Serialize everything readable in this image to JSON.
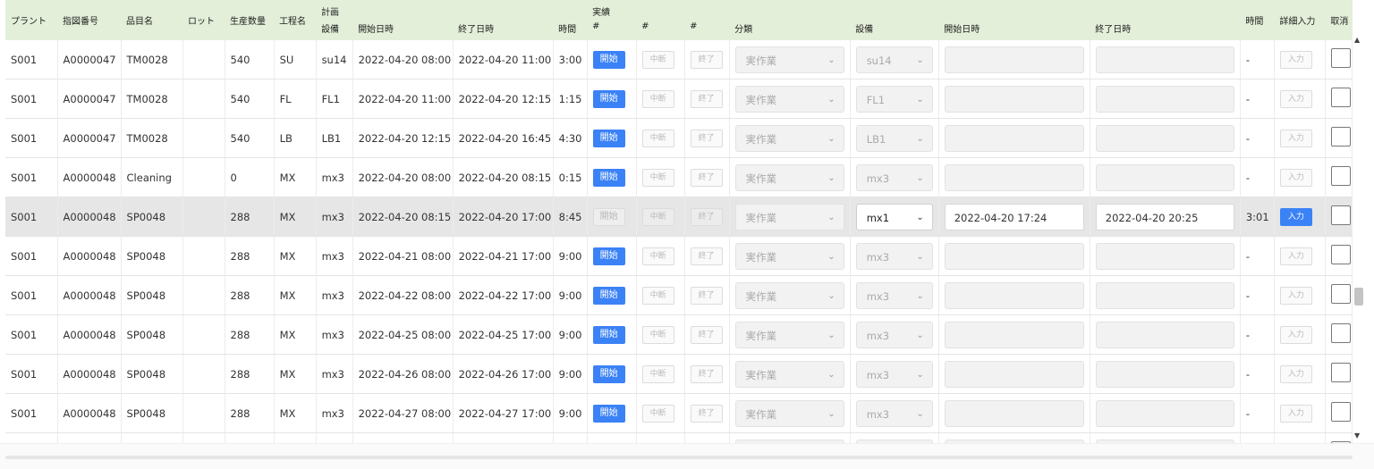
{
  "header": {
    "plant": "プラント",
    "order_no": "指図番号",
    "item_name": "品目名",
    "lot": "ロット",
    "qty": "生産数量",
    "process": "工程名",
    "plan_group": "計画",
    "plan_equipment": "設備",
    "plan_start": "開始日時",
    "plan_end": "終了日時",
    "plan_hours": "時間",
    "actual_group": "実績",
    "hash1": "#",
    "hash2": "#",
    "hash3": "#",
    "category": "分類",
    "actual_equipment": "設備",
    "actual_start": "開始日時",
    "actual_end": "終了日時",
    "actual_hours": "時間",
    "detail_input": "詳細入力",
    "cancel": "取消"
  },
  "labels": {
    "start": "開始",
    "pause": "中断",
    "finish": "終了",
    "input": "入力"
  },
  "rows": [
    {
      "plant": "S001",
      "order": "A0000047",
      "item": "TM0028",
      "lot": "",
      "qty": "540",
      "process": "SU",
      "equip": "su14",
      "start": "2022-04-20 08:00",
      "end": "2022-04-20 11:00",
      "hours": "3:00",
      "category": "実作業",
      "actual_equip": "su14",
      "actual_start": "",
      "actual_end": "",
      "actual_hours": "-"
    },
    {
      "plant": "S001",
      "order": "A0000047",
      "item": "TM0028",
      "lot": "",
      "qty": "540",
      "process": "FL",
      "equip": "FL1",
      "start": "2022-04-20 11:00",
      "end": "2022-04-20 12:15",
      "hours": "1:15",
      "category": "実作業",
      "actual_equip": "FL1",
      "actual_start": "",
      "actual_end": "",
      "actual_hours": "-"
    },
    {
      "plant": "S001",
      "order": "A0000047",
      "item": "TM0028",
      "lot": "",
      "qty": "540",
      "process": "LB",
      "equip": "LB1",
      "start": "2022-04-20 12:15",
      "end": "2022-04-20 16:45",
      "hours": "4:30",
      "category": "実作業",
      "actual_equip": "LB1",
      "actual_start": "",
      "actual_end": "",
      "actual_hours": "-"
    },
    {
      "plant": "S001",
      "order": "A0000048",
      "item": "Cleaning",
      "lot": "",
      "qty": "0",
      "process": "MX",
      "equip": "mx3",
      "start": "2022-04-20 08:00",
      "end": "2022-04-20 08:15",
      "hours": "0:15",
      "category": "実作業",
      "actual_equip": "mx3",
      "actual_start": "",
      "actual_end": "",
      "actual_hours": "-"
    },
    {
      "plant": "S001",
      "order": "A0000048",
      "item": "SP0048",
      "lot": "",
      "qty": "288",
      "process": "MX",
      "equip": "mx3",
      "start": "2022-04-20 08:15",
      "end": "2022-04-20 17:00",
      "hours": "8:45",
      "category": "実作業",
      "actual_equip": "mx1",
      "actual_start": "2022-04-20 17:24",
      "actual_end": "2022-04-20 20:25",
      "actual_hours": "3:01",
      "active": true
    },
    {
      "plant": "S001",
      "order": "A0000048",
      "item": "SP0048",
      "lot": "",
      "qty": "288",
      "process": "MX",
      "equip": "mx3",
      "start": "2022-04-21 08:00",
      "end": "2022-04-21 17:00",
      "hours": "9:00",
      "category": "実作業",
      "actual_equip": "mx3",
      "actual_start": "",
      "actual_end": "",
      "actual_hours": "-"
    },
    {
      "plant": "S001",
      "order": "A0000048",
      "item": "SP0048",
      "lot": "",
      "qty": "288",
      "process": "MX",
      "equip": "mx3",
      "start": "2022-04-22 08:00",
      "end": "2022-04-22 17:00",
      "hours": "9:00",
      "category": "実作業",
      "actual_equip": "mx3",
      "actual_start": "",
      "actual_end": "",
      "actual_hours": "-"
    },
    {
      "plant": "S001",
      "order": "A0000048",
      "item": "SP0048",
      "lot": "",
      "qty": "288",
      "process": "MX",
      "equip": "mx3",
      "start": "2022-04-25 08:00",
      "end": "2022-04-25 17:00",
      "hours": "9:00",
      "category": "実作業",
      "actual_equip": "mx3",
      "actual_start": "",
      "actual_end": "",
      "actual_hours": "-"
    },
    {
      "plant": "S001",
      "order": "A0000048",
      "item": "SP0048",
      "lot": "",
      "qty": "288",
      "process": "MX",
      "equip": "mx3",
      "start": "2022-04-26 08:00",
      "end": "2022-04-26 17:00",
      "hours": "9:00",
      "category": "実作業",
      "actual_equip": "mx3",
      "actual_start": "",
      "actual_end": "",
      "actual_hours": "-"
    },
    {
      "plant": "S001",
      "order": "A0000048",
      "item": "SP0048",
      "lot": "",
      "qty": "288",
      "process": "MX",
      "equip": "mx3",
      "start": "2022-04-27 08:00",
      "end": "2022-04-27 17:00",
      "hours": "9:00",
      "category": "実作業",
      "actual_equip": "mx3",
      "actual_start": "",
      "actual_end": "",
      "actual_hours": "-"
    },
    {
      "plant": "",
      "order": "",
      "item": "",
      "lot": "",
      "qty": "",
      "process": "",
      "equip": "",
      "start": "",
      "end": "",
      "hours": "",
      "category": "",
      "actual_equip": "",
      "actual_start": "",
      "actual_end": "",
      "actual_hours": "",
      "partial": true
    }
  ],
  "icons": {
    "dropdown": "chevron-down-icon",
    "scroll_up": "scroll-up-arrow-icon",
    "scroll_down": "scroll-down-arrow-icon"
  },
  "colors": {
    "header_bg": "#e3efd9",
    "primary": "#3b82f6",
    "selected_row": "#e6e6e6"
  }
}
